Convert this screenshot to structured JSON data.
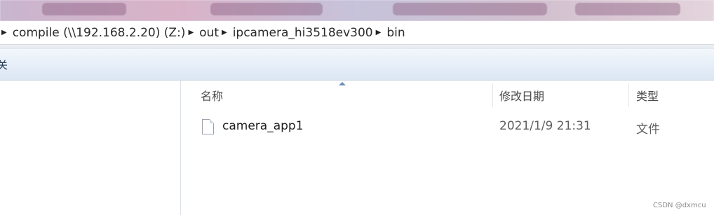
{
  "address_bar": {
    "crumbs": [
      "compile (\\\\192.168.2.20) (Z:)",
      "out",
      "ipcamera_hi3518ev300",
      "bin"
    ]
  },
  "toolbar": {
    "cutoff_glyph": "关"
  },
  "columns": {
    "name": "名称",
    "modified": "修改日期",
    "type": "类型"
  },
  "files": [
    {
      "name": "camera_app1",
      "modified": "2021/1/9 21:31",
      "type": "文件",
      "icon": "generic-file-icon"
    }
  ],
  "watermark": "CSDN @dxmcu"
}
